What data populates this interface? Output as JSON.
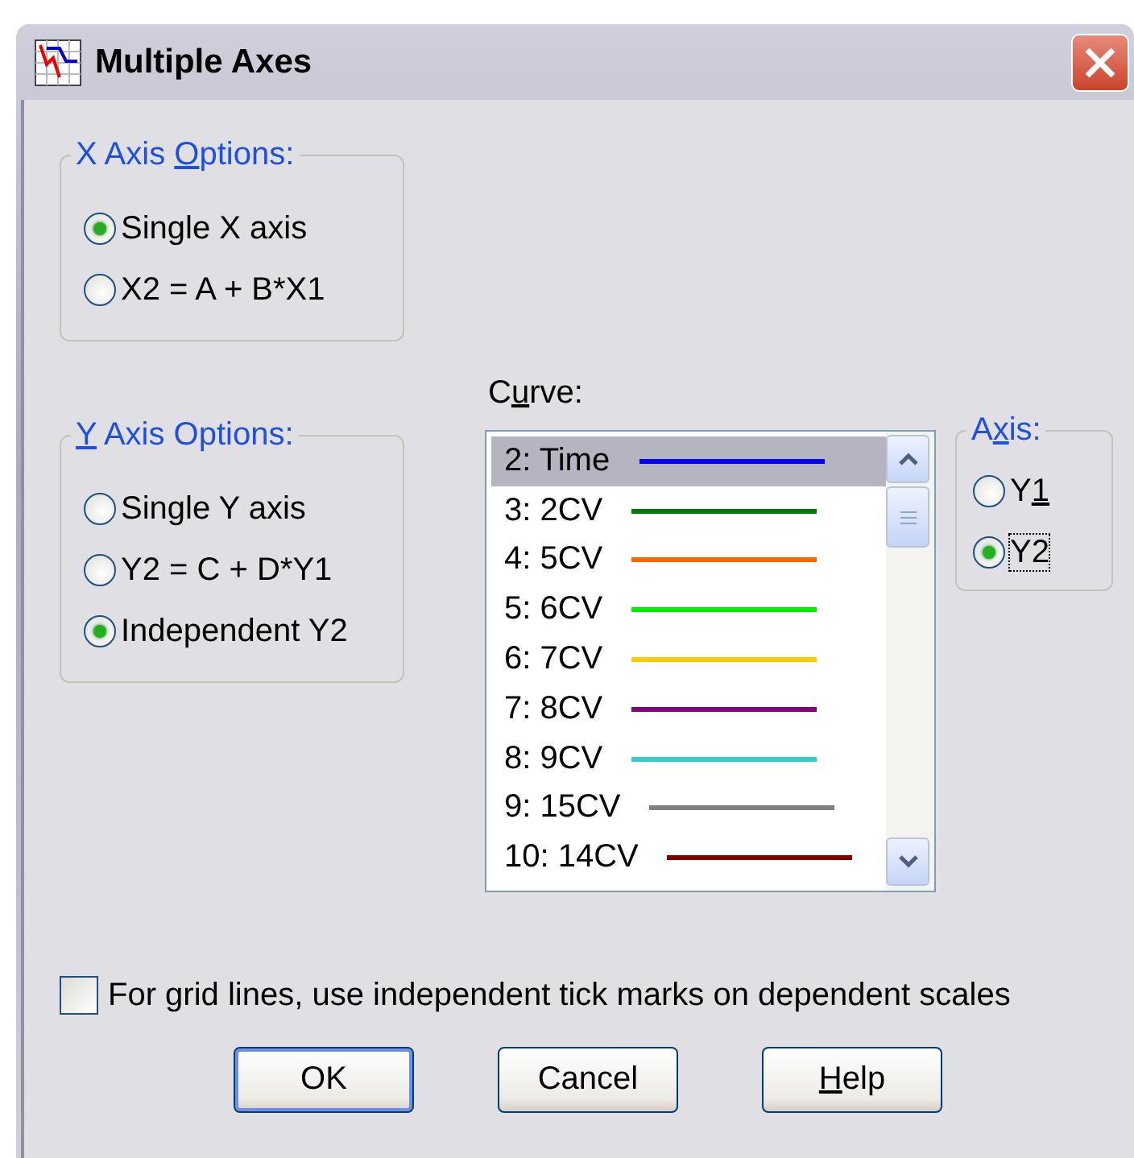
{
  "window": {
    "title": "Multiple Axes"
  },
  "x_axis_options": {
    "legend": {
      "before": "X Axis ",
      "key": "O",
      "after": "ptions:"
    },
    "options": [
      {
        "label": "Single X axis",
        "selected": true
      },
      {
        "label": "X2 = A + B*X1",
        "selected": false
      }
    ]
  },
  "y_axis_options": {
    "legend": {
      "key": "Y",
      "after": " Axis Options:"
    },
    "options": [
      {
        "label": "Single Y axis",
        "selected": false
      },
      {
        "label": "Y2 = C + D*Y1",
        "selected": false
      },
      {
        "label": "Independent Y2",
        "selected": true
      }
    ]
  },
  "curve": {
    "label": {
      "before": "C",
      "key": "u",
      "after": "rve:"
    },
    "items": [
      {
        "label": "2: Time",
        "color": "#0000ff",
        "selected": true
      },
      {
        "label": "3: 2CV",
        "color": "#007a00",
        "selected": false
      },
      {
        "label": "4: 5CV",
        "color": "#ff6600",
        "selected": false
      },
      {
        "label": "5: 6CV",
        "color": "#00ee00",
        "selected": false
      },
      {
        "label": "6: 7CV",
        "color": "#ffcc00",
        "selected": false
      },
      {
        "label": "7: 8CV",
        "color": "#800080",
        "selected": false
      },
      {
        "label": "8: 9CV",
        "color": "#33cccc",
        "selected": false
      },
      {
        "label": "9: 15CV",
        "color": "#808080",
        "selected": false
      },
      {
        "label": "10: 14CV",
        "color": "#800000",
        "selected": false
      }
    ]
  },
  "axis": {
    "legend": {
      "before": "A",
      "key": "x",
      "after": "is:"
    },
    "options": [
      {
        "label": {
          "before": "Y",
          "key": "1"
        },
        "selected": false,
        "focused": false
      },
      {
        "label": "Y2",
        "selected": true,
        "focused": true
      }
    ]
  },
  "grid_option": {
    "label": "For grid lines, use independent tick marks on dependent scales",
    "checked": false
  },
  "buttons": [
    {
      "label": "OK",
      "default": true
    },
    {
      "label": "Cancel",
      "default": false
    },
    {
      "label": {
        "key": "H",
        "after": "elp"
      },
      "default": false
    }
  ]
}
